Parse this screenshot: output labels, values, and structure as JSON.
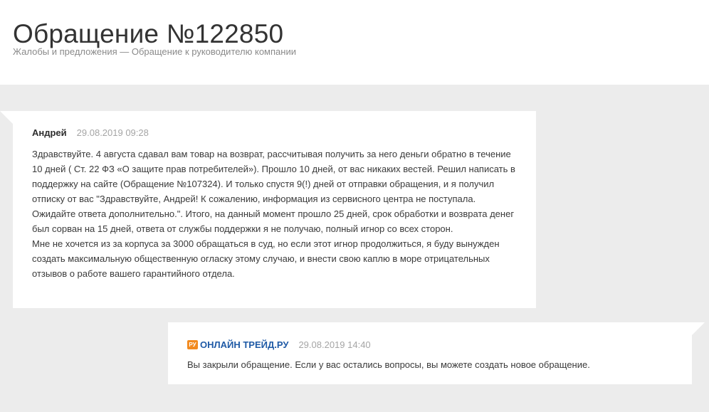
{
  "page": {
    "title": "Обращение №122850",
    "breadcrumb": "Жалобы и предложения — Обращение к руководителю компании"
  },
  "messages": {
    "user": {
      "author": "Андрей",
      "date": "29.08.2019 09:28",
      "paragraph_1": "Здравствуйте. 4 августа сдавал вам товар на возврат, рассчитывая получить за него деньги обратно в течение 10 дней ( Ст. 22 ФЗ «О защите прав потребителей»). Прошло 10 дней, от вас никаких вестей. Решил написать в поддержку на сайте (Обращение №107324). И только спустя 9(!) дней от отправки обращения, и я получил отписку от вас \"Здравствуйте, Андрей! К сожалению, информация из сервисного центра не поступала. Ожидайте ответа дополнительно.\". Итого, на данный момент прошло 25 дней, срок обработки и возврата денег был сорван на 15 дней, ответа от службы поддержки я не получаю, полный игнор со всех сторон.",
      "paragraph_2": "Мне не хочется из за корпуса за 3000 обращаться в суд, но если этот игнор продолжиться, я буду вынужден создать максимальную общественную огласку этому случаю, и внести свою каплю в море отрицательных отзывов о работе вашего гарантийного отдела."
    },
    "company": {
      "badge": "РУ",
      "brand_name": "ОНЛАЙН ТРЕЙД.РУ",
      "date": "29.08.2019 14:40",
      "text": "Вы закрыли обращение. Если у вас остались вопросы, вы можете создать новое обращение."
    }
  },
  "colors": {
    "thread_background": "#ececec",
    "brand_blue": "#1f5aa6",
    "brand_orange": "#f28a1f",
    "date_gray": "#a5a5a5"
  }
}
